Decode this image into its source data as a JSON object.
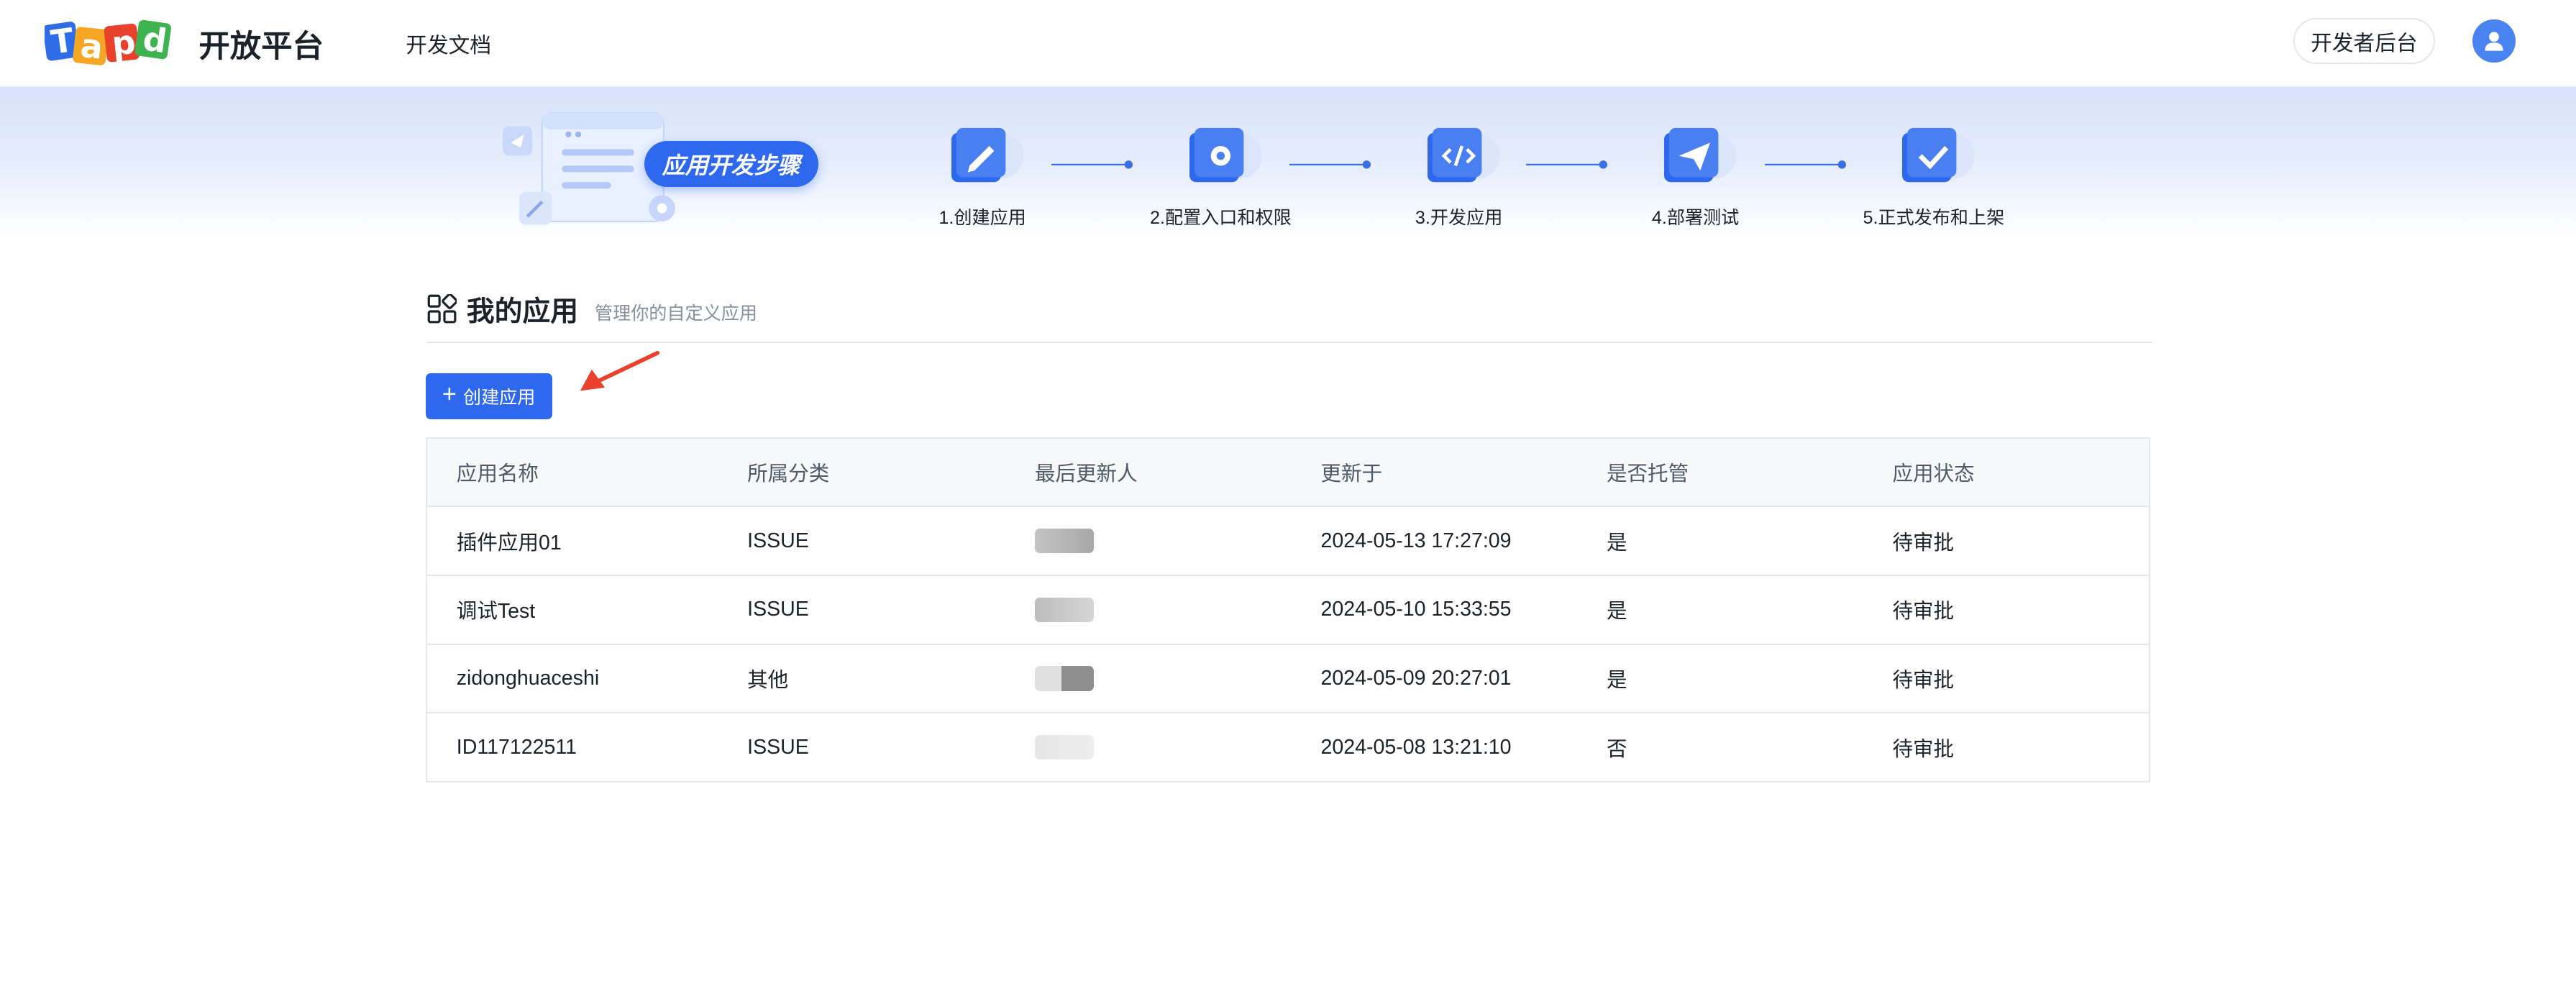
{
  "header": {
    "brand_title": "开放平台",
    "nav_docs": "开发文档",
    "console_button": "开发者后台",
    "logo_text": "Tapd"
  },
  "banner": {
    "steps_title": "应用开发步骤",
    "steps": [
      {
        "label": "1.创建应用",
        "icon": "pencil-icon"
      },
      {
        "label": "2.配置入口和权限",
        "icon": "gear-icon"
      },
      {
        "label": "3.开发应用",
        "icon": "code-icon"
      },
      {
        "label": "4.部署测试",
        "icon": "paper-plane-icon"
      },
      {
        "label": "5.正式发布和上架",
        "icon": "check-icon"
      }
    ]
  },
  "section": {
    "title": "我的应用",
    "subtitle": "管理你的自定义应用"
  },
  "create_button": {
    "label": "创建应用"
  },
  "table": {
    "columns": [
      "应用名称",
      "所属分类",
      "最后更新人",
      "更新于",
      "是否托管",
      "应用状态"
    ],
    "rows": [
      {
        "name": "插件应用01",
        "category": "ISSUE",
        "updated_at": "2024-05-13 17:27:09",
        "hosted": "是",
        "status": "待审批"
      },
      {
        "name": "调试Test",
        "category": "ISSUE",
        "updated_at": "2024-05-10 15:33:55",
        "hosted": "是",
        "status": "待审批"
      },
      {
        "name": "zidonghuaceshi",
        "category": "其他",
        "updated_at": "2024-05-09 20:27:01",
        "hosted": "是",
        "status": "待审批"
      },
      {
        "name": "ID117122511",
        "category": "ISSUE",
        "updated_at": "2024-05-08 13:21:10",
        "hosted": "否",
        "status": "待审批"
      }
    ]
  },
  "colors": {
    "primary": "#2e68ee",
    "text": "#1d2129",
    "muted": "#86909c",
    "annotation_arrow": "#e8412c"
  }
}
